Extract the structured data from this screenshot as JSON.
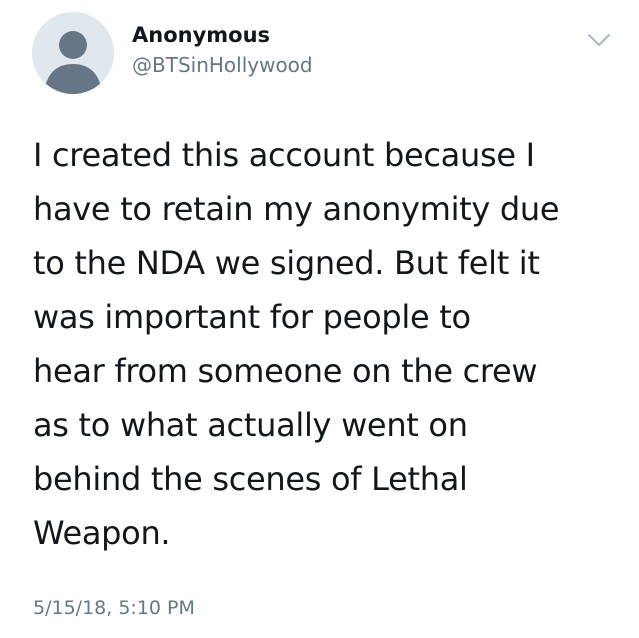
{
  "tweet": {
    "author": {
      "display_name": "Anonymous",
      "handle": "@BTSinHollywood",
      "avatar_icon": "default-profile-icon"
    },
    "menu_icon": "chevron-down-icon",
    "text_lines": [
      "I created this account because I",
      "have to retain my anonymity due",
      "to the NDA we signed. But felt it",
      "was important for people to",
      "hear from someone on the crew",
      "as to what actually went on",
      "behind the scenes of Lethal",
      "Weapon."
    ],
    "timestamp": "5/15/18, 5:10 PM"
  },
  "colors": {
    "text_primary": "#14171a",
    "text_secondary": "#657786",
    "avatar_background": "#e1e8ed",
    "avatar_silhouette": "#657786",
    "background": "#ffffff"
  }
}
